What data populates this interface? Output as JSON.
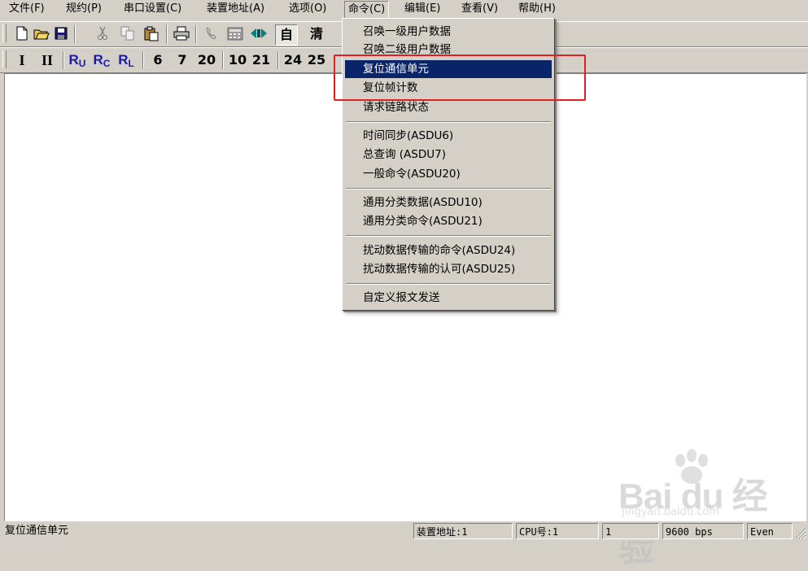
{
  "menubar": {
    "items": [
      {
        "label": "文件(F)"
      },
      {
        "label": "规约(P)"
      },
      {
        "label": "串口设置(C)"
      },
      {
        "label": "装置地址(A)"
      },
      {
        "label": "选项(O)"
      },
      {
        "label": "命令(C)"
      },
      {
        "label": "编辑(E)"
      },
      {
        "label": "查看(V)"
      },
      {
        "label": "帮助(H)"
      }
    ]
  },
  "toolbar1": {
    "buttons": [
      {
        "icon": "new-file-icon"
      },
      {
        "icon": "open-folder-icon"
      },
      {
        "icon": "save-icon"
      },
      {
        "icon": "cut-icon"
      },
      {
        "icon": "copy-icon"
      },
      {
        "icon": "paste-icon"
      },
      {
        "icon": "print-icon"
      },
      {
        "icon": "phone-icon"
      },
      {
        "icon": "calculator-icon"
      },
      {
        "icon": "transmit-icon"
      }
    ],
    "auto_label": "自",
    "clear_label": "清"
  },
  "toolbar2": {
    "roman1": "I",
    "roman2": "II",
    "ru": {
      "main": "R",
      "sub": "U"
    },
    "rc": {
      "main": "R",
      "sub": "C"
    },
    "rl": {
      "main": "R",
      "sub": "L"
    },
    "asdu_buttons": [
      "6",
      "7",
      "20",
      "10",
      "21",
      "24",
      "25"
    ]
  },
  "command_menu": {
    "items": [
      {
        "label": "召唤一级用户数据"
      },
      {
        "label": "召唤二级用户数据"
      },
      {
        "label": "复位通信单元",
        "highlighted": true
      },
      {
        "label": "复位帧计数"
      },
      {
        "label": "请求链路状态"
      },
      {
        "label": "时间同步(ASDU6)"
      },
      {
        "label": "总查询 (ASDU7)"
      },
      {
        "label": "一般命令(ASDU20)"
      },
      {
        "label": "通用分类数据(ASDU10)"
      },
      {
        "label": "通用分类命令(ASDU21)"
      },
      {
        "label": "扰动数据传输的命令(ASDU24)"
      },
      {
        "label": "扰动数据传输的认可(ASDU25)"
      },
      {
        "label": "自定义报文发送"
      }
    ]
  },
  "statusbar": {
    "message": "复位通信单元",
    "device_address": "装置地址:1",
    "cpu": "CPU号:1",
    "field3": "1",
    "baud": "9600 bps",
    "parity": "Even"
  },
  "watermark": {
    "text": "Bai du 经验",
    "sub": "jingyan.baidu.com"
  },
  "colors": {
    "menu_highlight": "#0a246a",
    "annotation_box": "#e02020"
  }
}
